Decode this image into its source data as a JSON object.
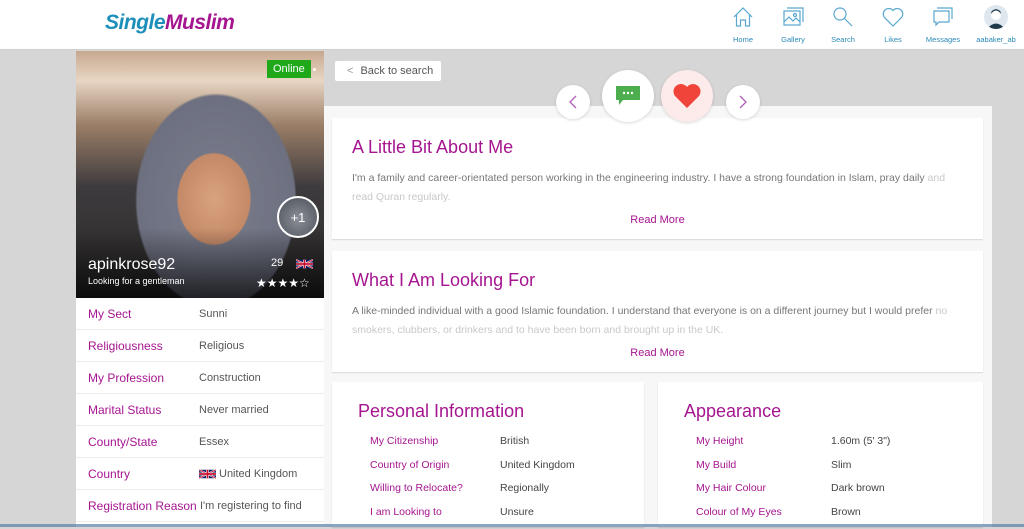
{
  "header": {
    "logo_part1": "Single",
    "logo_part2": "Muslim",
    "nav": [
      {
        "label": "Home",
        "icon": "home-icon"
      },
      {
        "label": "Gallery",
        "icon": "gallery-icon"
      },
      {
        "label": "Search",
        "icon": "search-icon"
      },
      {
        "label": "Likes",
        "icon": "heart-icon"
      },
      {
        "label": "Messages",
        "icon": "messages-icon"
      },
      {
        "label": "aabaker_ab",
        "icon": "user-avatar"
      }
    ]
  },
  "profile": {
    "status": "Online",
    "extra_photos": "+1",
    "username": "apinkrose92",
    "tagline": "Looking for a gentleman",
    "age": "29",
    "rating": 4,
    "rating_max": 5,
    "stars_text": "★★★★☆",
    "details": [
      {
        "label": "My Sect",
        "value": "Sunni"
      },
      {
        "label": "Religiousness",
        "value": "Religious"
      },
      {
        "label": "My Profession",
        "value": "Construction"
      },
      {
        "label": "Marital Status",
        "value": "Never married"
      },
      {
        "label": "County/State",
        "value": "Essex"
      },
      {
        "label": "Country",
        "value": "United Kingdom"
      },
      {
        "label": "Registration Reason",
        "value": "I'm registering to find"
      }
    ]
  },
  "actions": {
    "back_label": "Back to search",
    "back_chevron": "<",
    "prev_chevron": "‹",
    "next_chevron": "›"
  },
  "about": {
    "title": "A Little Bit About Me",
    "text": "I'm a family and career-orientated person working in the engineering industry. I have a strong foundation in Islam, pray daily",
    "text_faded": "and read Quran regularly.",
    "read_more": "Read More"
  },
  "looking_for": {
    "title": "What I Am Looking For",
    "text": "A like-minded individual with a good Islamic foundation. I understand that everyone is on a different journey but I would prefer",
    "text_faded": "no smokers, clubbers, or drinkers and to have been born and brought up in the UK.",
    "read_more": "Read More"
  },
  "personal_info": {
    "title": "Personal Information",
    "rows": [
      {
        "label": "My Citizenship",
        "value": "British"
      },
      {
        "label": "Country of Origin",
        "value": "United Kingdom"
      },
      {
        "label": "Willing to Relocate?",
        "value": "Regionally"
      },
      {
        "label": "I am Looking to",
        "value": "Unsure"
      }
    ]
  },
  "appearance": {
    "title": "Appearance",
    "rows": [
      {
        "label": "My Height",
        "value": "1.60m (5' 3\")"
      },
      {
        "label": "My Build",
        "value": "Slim"
      },
      {
        "label": "My Hair Colour",
        "value": "Dark brown"
      },
      {
        "label": "Colour of My Eyes",
        "value": "Brown"
      }
    ]
  },
  "colors": {
    "brand_blue": "#1e8fb8",
    "brand_purple": "#a5158f",
    "online_green": "#1ea81a",
    "like_red": "#f0443a",
    "message_green": "#4cae4f"
  }
}
